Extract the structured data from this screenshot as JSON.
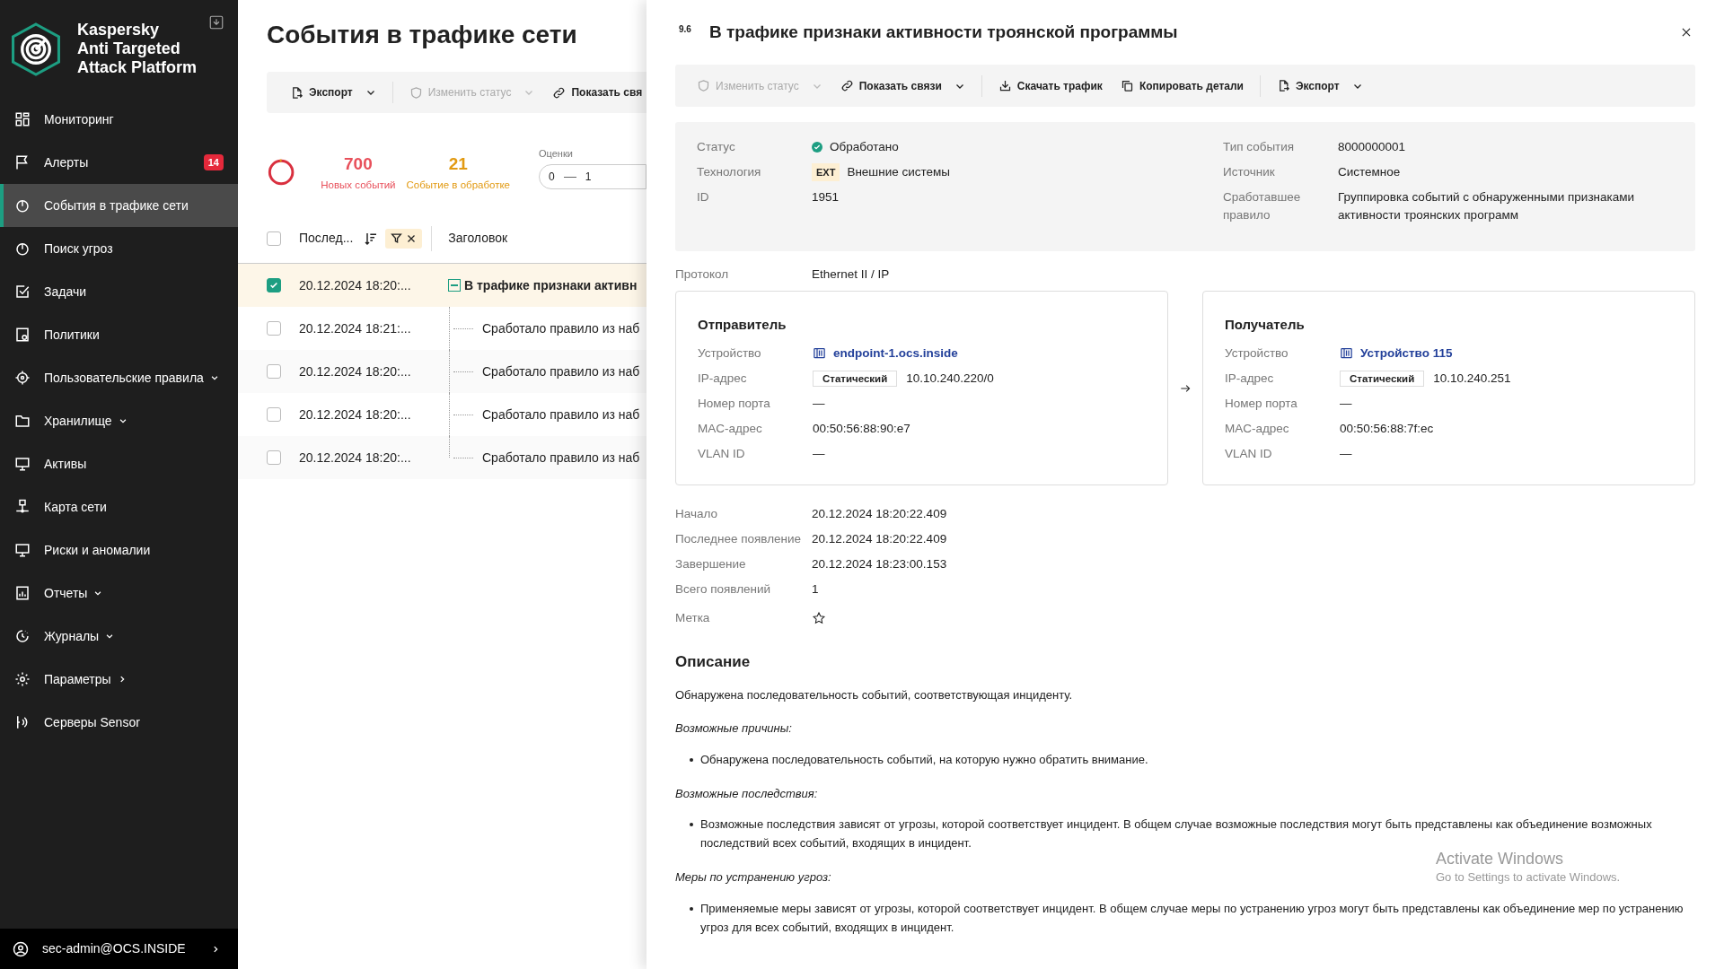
{
  "sidebar": {
    "logo_lines": [
      "Kaspersky",
      "Anti Targeted",
      "Attack Platform"
    ],
    "items": [
      {
        "label": "Мониторинг",
        "selected": false
      },
      {
        "label": "Алерты",
        "selected": false,
        "badge": "14"
      },
      {
        "label": "События в трафике сети",
        "selected": true
      },
      {
        "label": "Поиск угроз",
        "selected": false
      },
      {
        "label": "Задачи",
        "selected": false
      },
      {
        "label": "Политики",
        "selected": false
      },
      {
        "label": "Пользовательские правила",
        "selected": false,
        "kind": "group"
      },
      {
        "label": "Хранилище",
        "selected": false,
        "kind": "group"
      },
      {
        "label": "Активы",
        "selected": false
      },
      {
        "label": "Карта сети",
        "selected": false
      },
      {
        "label": "Риски и аномалии",
        "selected": false
      },
      {
        "label": "Отчеты",
        "selected": false,
        "kind": "group"
      },
      {
        "label": "Журналы",
        "selected": false,
        "kind": "group"
      },
      {
        "label": "Параметры",
        "selected": false,
        "kind": "submenu"
      },
      {
        "label": "Серверы Sensor",
        "selected": false
      }
    ],
    "user": "sec-admin@OCS.INSIDE"
  },
  "main": {
    "title": "События в трафике сети",
    "toolbar": [
      [
        {
          "label": "Экспорт",
          "disabled": false,
          "dropdown": true
        }
      ],
      [
        {
          "label": "Изменить статус",
          "disabled": true,
          "dropdown": true
        },
        {
          "label": "Показать свя",
          "disabled": false,
          "dropdown": false
        }
      ]
    ],
    "stats": [
      {
        "value": "700",
        "label": "Новых событий",
        "color": "#e8505b"
      },
      {
        "value": "21",
        "label": "Событие в обработке",
        "color": "#e29a12"
      }
    ],
    "ratings": {
      "label": "Оценки",
      "from": "0",
      "to": "1"
    },
    "table": {
      "all_checked": false,
      "columns": [
        "Послед...",
        "Заголовок"
      ],
      "rows": [
        {
          "kind": "group",
          "checked": true,
          "selected": true,
          "time": "20.12.2024 18:20:...",
          "title": "В трафике признаки активн"
        },
        {
          "kind": "child",
          "checked": false,
          "selected": false,
          "time": "20.12.2024 18:21:...",
          "title": "Сработало правило из наб"
        },
        {
          "kind": "child",
          "checked": false,
          "selected": false,
          "time": "20.12.2024 18:20:...",
          "title": "Сработало правило из наб"
        },
        {
          "kind": "child",
          "checked": false,
          "selected": false,
          "time": "20.12.2024 18:20:...",
          "title": "Сработало правило из наб"
        },
        {
          "kind": "child",
          "checked": false,
          "selected": false,
          "time": "20.12.2024 18:20:...",
          "title": "Сработало правило из наб"
        }
      ]
    }
  },
  "drawer": {
    "score": "9.6",
    "title": "В трафике признаки активности троянской программы",
    "toolbar": [
      [
        {
          "label": "Изменить статус",
          "disabled": true,
          "dropdown": true
        },
        {
          "label": "Показать связи",
          "disabled": false,
          "dropdown": true
        }
      ],
      [
        {
          "label": "Скачать трафик",
          "disabled": false,
          "dropdown": false
        },
        {
          "label": "Копировать детали",
          "disabled": false,
          "dropdown": false
        }
      ],
      [
        {
          "label": "Экспорт",
          "disabled": false,
          "dropdown": true
        }
      ]
    ],
    "summary_left": [
      {
        "kind": "status",
        "label": "Статус",
        "value": "Обработано"
      },
      {
        "kind": "tech",
        "label": "Технология",
        "tag": "EXT",
        "value": "Внешние системы"
      },
      {
        "label": "ID",
        "value": "1951"
      }
    ],
    "summary_right": [
      {
        "label": "Тип события",
        "value": "8000000001"
      },
      {
        "label": "Источник",
        "value": "Системное"
      },
      {
        "label": "Сработавшее правило",
        "value": "Группировка событий с обнаруженными признаками активности троянских программ"
      }
    ],
    "protocol": {
      "label": "Протокол",
      "value": "Ethernet II / IP"
    },
    "endpoints": [
      {
        "title": "Отправитель",
        "fields": [
          {
            "kind": "device",
            "label": "Устройство",
            "value": "endpoint-1.ocs.inside"
          },
          {
            "kind": "ip",
            "label": "IP-адрес",
            "tag": "Статический",
            "value": "10.10.240.220/0"
          },
          {
            "label": "Номер порта",
            "value": "—"
          },
          {
            "label": "MAC-адрес",
            "value": "00:50:56:88:90:e7"
          },
          {
            "label": "VLAN ID",
            "value": "—"
          }
        ]
      },
      {
        "title": "Получатель",
        "fields": [
          {
            "kind": "device",
            "label": "Устройство",
            "value": "Устройство 115"
          },
          {
            "kind": "ip",
            "label": "IP-адрес",
            "tag": "Статический",
            "value": "10.10.240.251"
          },
          {
            "label": "Номер порта",
            "value": "—"
          },
          {
            "label": "MAC-адрес",
            "value": "00:50:56:88:7f:ec"
          },
          {
            "label": "VLAN ID",
            "value": "—"
          }
        ]
      }
    ],
    "times": [
      {
        "label": "Начало",
        "value": "20.12.2024 18:20:22.409"
      },
      {
        "label": "Последнее появление",
        "value": "20.12.2024 18:20:22.409"
      },
      {
        "label": "Завершение",
        "value": "20.12.2024 18:23:00.153"
      },
      {
        "label": "Всего появлений",
        "value": "1"
      }
    ],
    "mark": {
      "label": "Метка",
      "starred": false
    },
    "description": {
      "heading": "Описание",
      "intro": "Обнаружена последовательность событий, соответствующая инциденту.",
      "sections": [
        {
          "heading": "Возможные причины:",
          "bullets": [
            "Обнаружена последовательность событий, на которую нужно обратить внимание."
          ]
        },
        {
          "heading": "Возможные последствия:",
          "bullets": [
            "Возможные последствия зависят от угрозы, которой соответствует инцидент. В общем случае возможные последствия могут быть представлены как объединение возможных последствий всех событий, входящих в инцидент."
          ]
        },
        {
          "heading": "Меры по устранению угроз:",
          "bullets": [
            "Применяемые меры зависят от угрозы, которой соответствует инцидент. В общем случае меры по устранению угроз могут быть представлены как объединение мер по устранению угроз для всех событий, входящих в инцидент."
          ]
        }
      ]
    }
  },
  "os_overlay": {
    "title": "Activate Windows",
    "subtitle": "Go to Settings to activate Windows."
  }
}
